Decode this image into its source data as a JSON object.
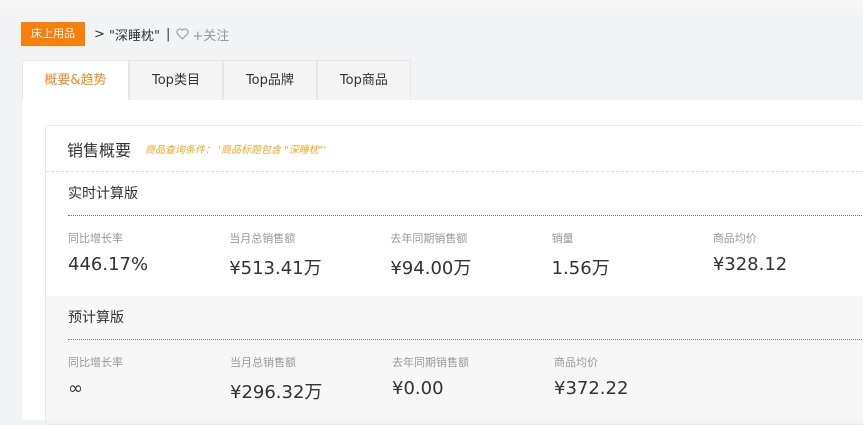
{
  "breadcrumb": {
    "category": "床上用品",
    "arrow": ">",
    "keyword": "\"深睡枕\"",
    "divider": "|",
    "follow": "+关注"
  },
  "tabs": [
    "概要&趋势",
    "Top类目",
    "Top品牌",
    "Top商品"
  ],
  "card": {
    "title": "销售概要",
    "condition": "商品查询条件： '商品标题包含 \"深睡枕\"'"
  },
  "realtime": {
    "title": "实时计算版",
    "metrics": [
      {
        "label": "同比增长率",
        "value": "446.17%"
      },
      {
        "label": "当月总销售额",
        "value": "¥513.41万"
      },
      {
        "label": "去年同期销售额",
        "value": "¥94.00万"
      },
      {
        "label": "销量",
        "value": "1.56万"
      },
      {
        "label": "商品均价",
        "value": "¥328.12"
      }
    ]
  },
  "precomputed": {
    "title": "预计算版",
    "metrics": [
      {
        "label": "同比增长率",
        "value": "∞"
      },
      {
        "label": "当月总销售额",
        "value": "¥296.32万"
      },
      {
        "label": "去年同期销售额",
        "value": "¥0.00"
      },
      {
        "label": "商品均价",
        "value": "¥372.22"
      }
    ]
  }
}
